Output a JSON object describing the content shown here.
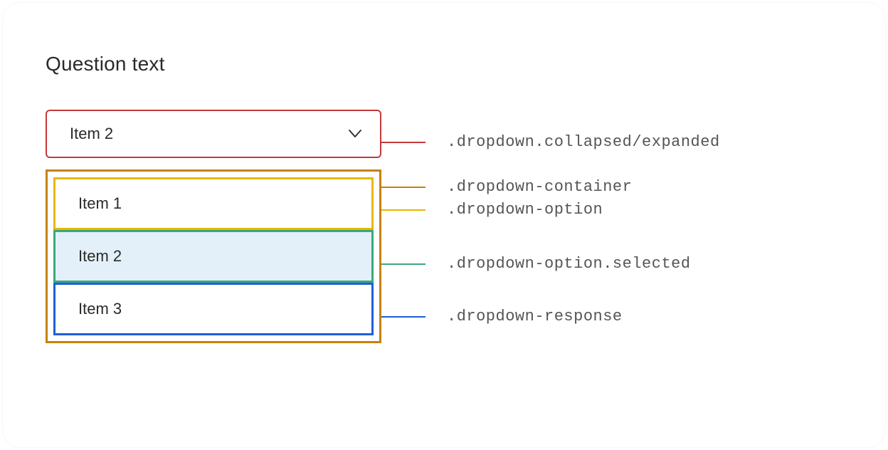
{
  "question": "Question text",
  "dropdown": {
    "selected_label": "Item 2",
    "options": [
      "Item 1",
      "Item 2",
      "Item 3"
    ]
  },
  "annotations": {
    "collapsed": ".dropdown.collapsed/expanded",
    "container": ".dropdown-container",
    "option": ".dropdown-option",
    "selected": ".dropdown-option.selected",
    "response": ".dropdown-response"
  }
}
